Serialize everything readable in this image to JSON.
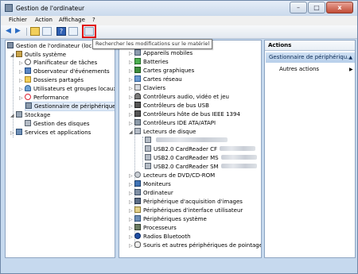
{
  "window": {
    "title": "Gestion de l'ordinateur",
    "controls": {
      "minimize": "–",
      "maximize": "□",
      "close": "x"
    }
  },
  "menubar": [
    "Fichier",
    "Action",
    "Affichage",
    "?"
  ],
  "toolbar": {
    "buttons": [
      "back-icon",
      "forward-icon",
      "up-icon",
      "properties-icon",
      "help-icon",
      "view-icon",
      "scan-hardware-icon"
    ],
    "tooltip": "Rechercher les modifications sur le matériel"
  },
  "left_tree": {
    "root": "Gestion de l'ordinateur (local)",
    "outils": "Outils système",
    "outils_children": [
      "Planificateur de tâches",
      "Observateur d'événements",
      "Dossiers partagés",
      "Utilisateurs et groupes locaux",
      "Performance",
      "Gestionnaire de périphériques"
    ],
    "stockage": "Stockage",
    "stockage_children": [
      "Gestion des disques"
    ],
    "services": "Services et applications"
  },
  "device_tree": {
    "items_before": [
      "Appareils mobiles",
      "Batteries",
      "Cartes graphiques",
      "Cartes réseau",
      "Claviers",
      "Contrôleurs audio, vidéo et jeu",
      "Contrôleurs de bus USB",
      "Contrôleurs hôte de bus IEEE 1394",
      "Contrôleurs IDE ATA/ATAPI"
    ],
    "expanded": "Lecteurs de disque",
    "disk_children": [
      "USB2.0 CardReader CF",
      "USB2.0 CardReader MS",
      "USB2.0 CardReader SM"
    ],
    "items_after": [
      "Lecteurs de DVD/CD-ROM",
      "Moniteurs",
      "Ordinateur",
      "Périphérique d'acquisition d'images",
      "Périphériques d'interface utilisateur",
      "Périphériques système",
      "Processeurs",
      "Radios Bluetooth",
      "Souris et autres périphériques de pointage"
    ]
  },
  "actions": {
    "header": "Actions",
    "selected": "Gestionnaire de périphériqu...",
    "other": "Autres actions"
  },
  "colors": {
    "highlight_box": "#e00000",
    "selection": "#dfe9f6"
  }
}
